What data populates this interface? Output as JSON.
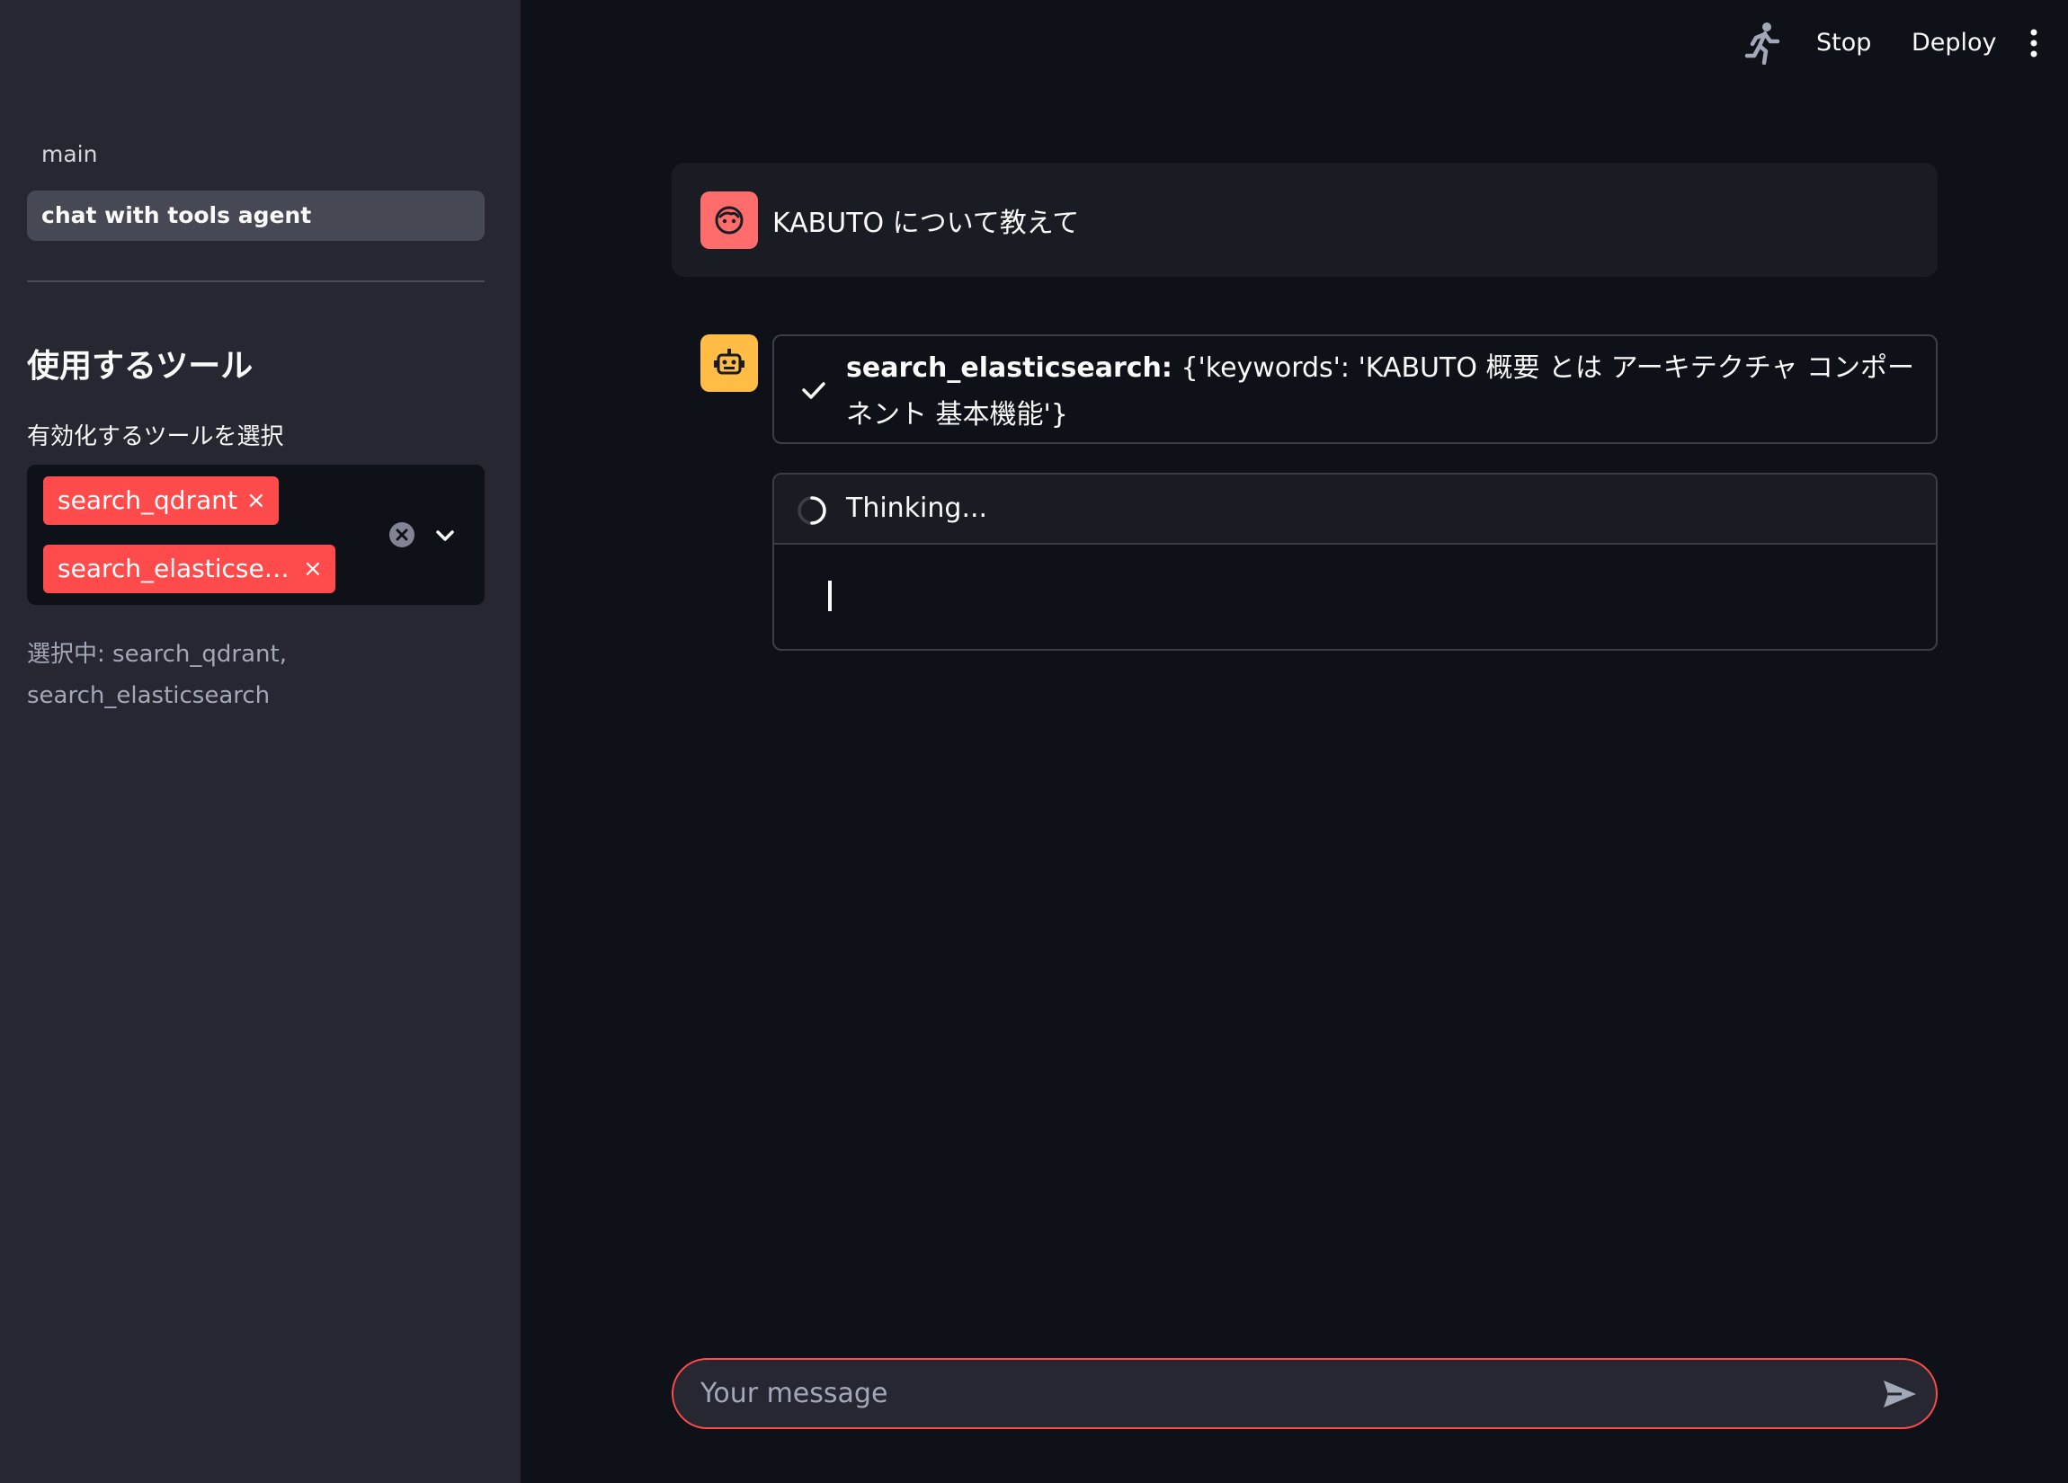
{
  "header": {
    "stop_label": "Stop",
    "deploy_label": "Deploy",
    "run_icon": "running-man-icon",
    "menu_icon": "vertical-ellipsis-icon"
  },
  "sidebar": {
    "nav_items": [
      {
        "label": "main",
        "active": false
      },
      {
        "label": "chat with tools agent",
        "active": true
      }
    ],
    "tools_heading": "使用するツール",
    "select_label": "有効化するツールを選択",
    "selected_tags": [
      {
        "label": "search_qdrant",
        "remove": "×"
      },
      {
        "label": "search_elasticse…",
        "remove": "×"
      }
    ],
    "selected_caption_line1": "選択中: search_qdrant,",
    "selected_caption_line2": "search_elasticsearch"
  },
  "chat": {
    "user_message": "KABUTO について教えて",
    "tool_call": {
      "name": "search_elasticsearch:",
      "args": "{'keywords': 'KABUTO 概要 とは アーキテクチャ コンポーネント 基本機能'}",
      "status_icon": "checkmark-icon"
    },
    "thinking_label": "Thinking..."
  },
  "input": {
    "placeholder": "Your message"
  },
  "colors": {
    "background": "#0e1117",
    "sidebar": "#262730",
    "accent": "#ff4b4b",
    "user_avatar": "#ff6c6c",
    "bot_avatar": "#ffbd45"
  }
}
